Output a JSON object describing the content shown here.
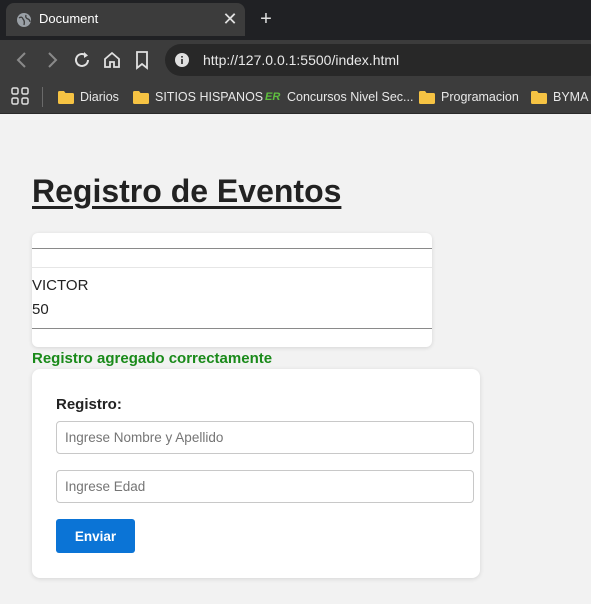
{
  "browser": {
    "tab_title": "Document",
    "url": "http://127.0.0.1:5500/index.html",
    "bookmarks": [
      {
        "label": "Diarios",
        "icon": "folder-icon"
      },
      {
        "label": "SITIOS HISPANOS",
        "icon": "folder-icon"
      },
      {
        "label": "Concursos Nivel Sec...",
        "icon": "er-icon"
      },
      {
        "label": "Programacion",
        "icon": "folder-icon"
      },
      {
        "label": "BYMA",
        "icon": "folder-icon"
      }
    ]
  },
  "page": {
    "title": "Registro de Eventos",
    "entries": [
      {
        "name": "VICTOR",
        "age": "50"
      }
    ],
    "success_message": "Registro agregado correctamente",
    "form": {
      "label": "Registro:",
      "name_placeholder": "Ingrese Nombre y Apellido",
      "age_placeholder": "Ingrese Edad",
      "submit_label": "Enviar"
    }
  },
  "colors": {
    "success": "#1a8a1a",
    "button": "#0b74d6",
    "chrome_dark": "#202124",
    "chrome_toolbar": "#3c3c3c",
    "folder": "#f6c343"
  }
}
